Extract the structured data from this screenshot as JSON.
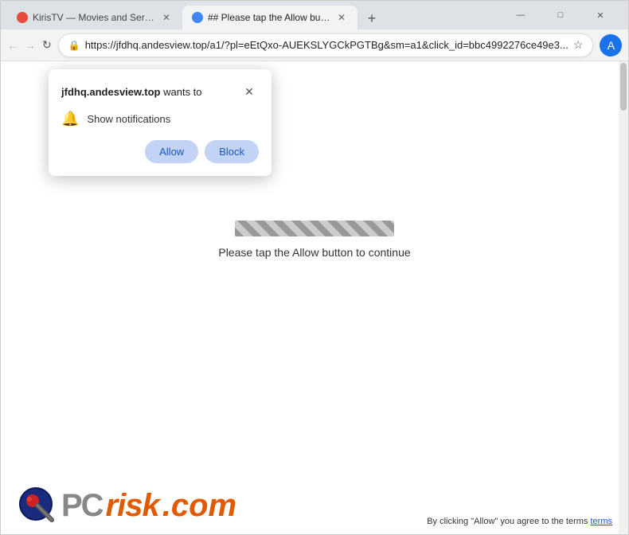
{
  "browser": {
    "tabs": [
      {
        "id": "tab1",
        "title": "KirisTV — Movies and Series D...",
        "active": false,
        "favicon": "red"
      },
      {
        "id": "tab2",
        "title": "## Please tap the Allow button...",
        "active": true,
        "favicon": "blue"
      }
    ],
    "new_tab_label": "+",
    "window_controls": {
      "minimize": "—",
      "maximize": "□",
      "close": "✕"
    },
    "nav": {
      "back": "←",
      "forward": "→",
      "refresh": "↻"
    },
    "address_bar": {
      "url": "https://jfdhq.andesview.top/a1/?pl=eEtQxo-AUEKSLYGCkPGTBg&sm=a1&click_id=bbc4992276ce49e3...",
      "secure_icon": "🔒"
    },
    "toolbar": {
      "star": "☆",
      "profile_initial": "A",
      "menu": "⋮"
    }
  },
  "popup": {
    "domain": "jfdhq.andesview.top",
    "wants_to": "wants to",
    "close_icon": "✕",
    "notification_icon": "🔔",
    "notification_text": "Show notifications",
    "allow_label": "Allow",
    "block_label": "Block"
  },
  "page": {
    "instruction_text": "Please tap the Allow button to continue",
    "bottom_notice": "By clicking \"Allow\" you agree to the terms"
  },
  "logo": {
    "pc_text": "PC",
    "risk_text": "risk",
    "com_text": ".com"
  }
}
